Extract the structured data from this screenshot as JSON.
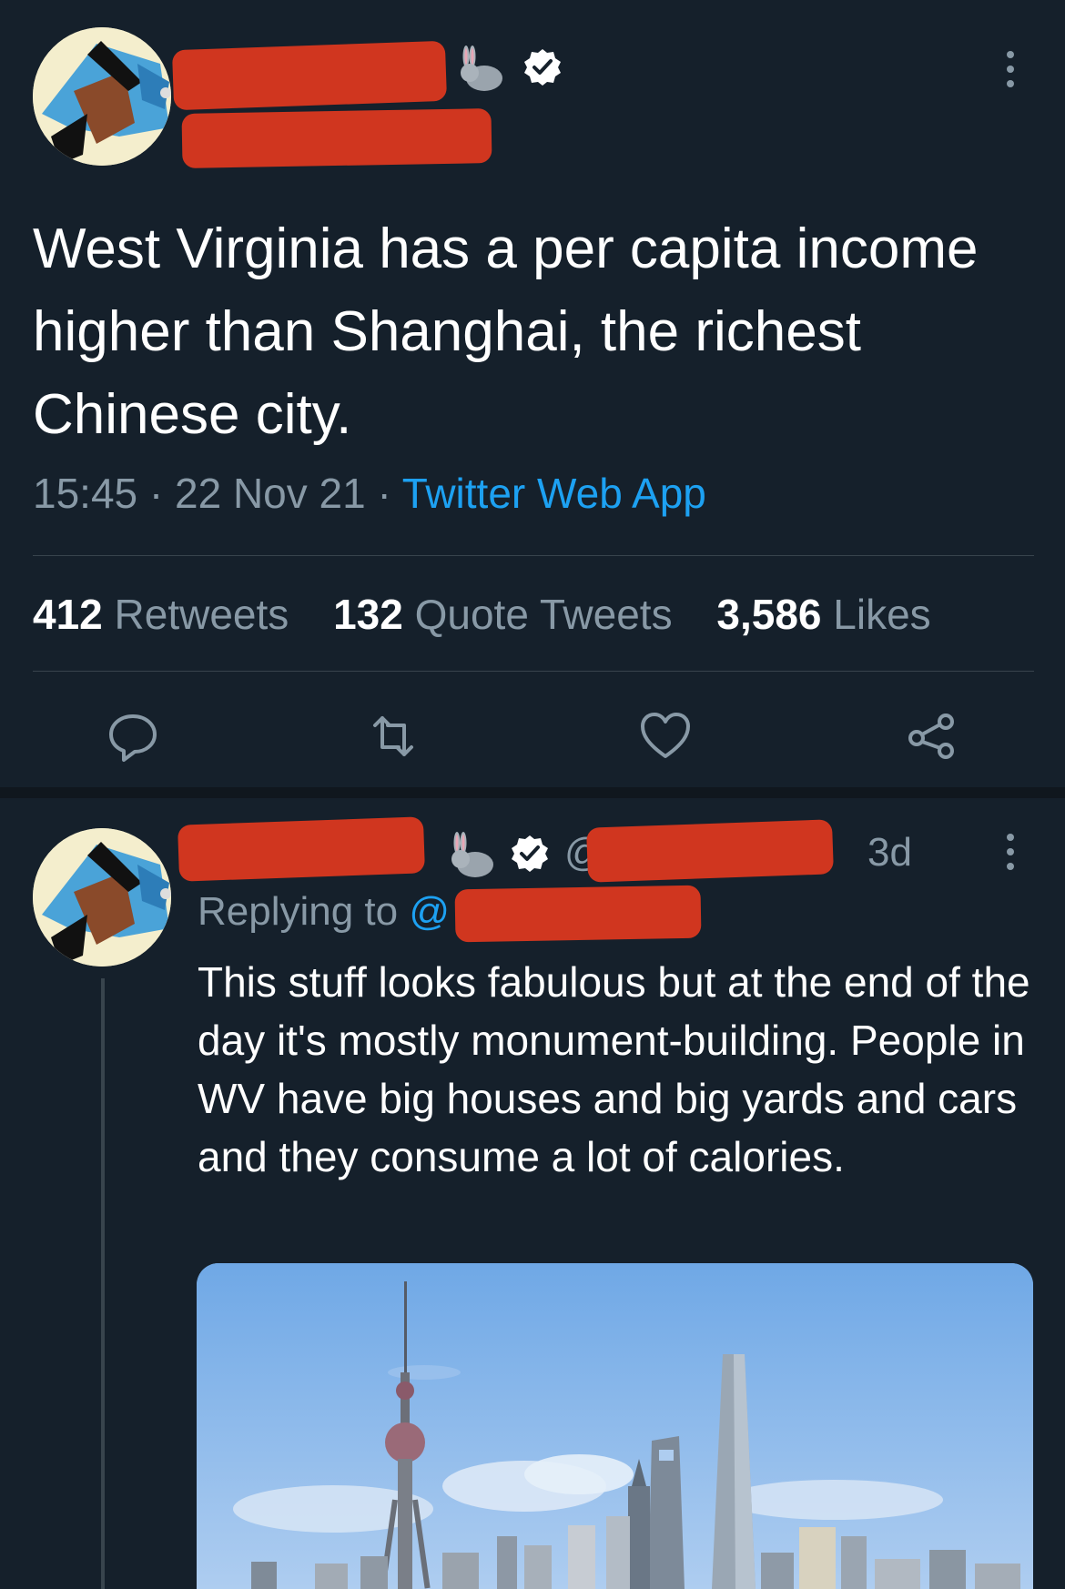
{
  "tweet": {
    "text": "West Virginia has a per capita income higher than Shanghai, the richest Chinese city.",
    "time": "15:45",
    "date": "22 Nov 21",
    "separator": "·",
    "client": "Twitter Web App",
    "stats": {
      "retweets_count": "412",
      "retweets_label": "Retweets",
      "quote_count": "132",
      "quote_label": "Quote Tweets",
      "likes_count": "3,586",
      "likes_label": "Likes"
    },
    "icons": {
      "more": "more-vertical-icon",
      "reply": "reply-icon",
      "retweet": "retweet-icon",
      "like": "heart-icon",
      "share": "share-icon",
      "verified": "verified-badge-icon",
      "emoji": "rabbit-emoji-icon"
    }
  },
  "reply": {
    "age": "3d",
    "handle_prefix": "@",
    "replying_to": "Replying to",
    "replying_at": "@",
    "text": "This stuff looks fabulous but at the end of the day it's mostly monument-building. People in WV have big houses and big yards and cars and they consume a lot of calories."
  },
  "colors": {
    "background": "#15202b",
    "text": "#ffffff",
    "secondary": "#8899a6",
    "link": "#1da1f2",
    "redaction": "#d0361f",
    "divider": "#38444d"
  }
}
